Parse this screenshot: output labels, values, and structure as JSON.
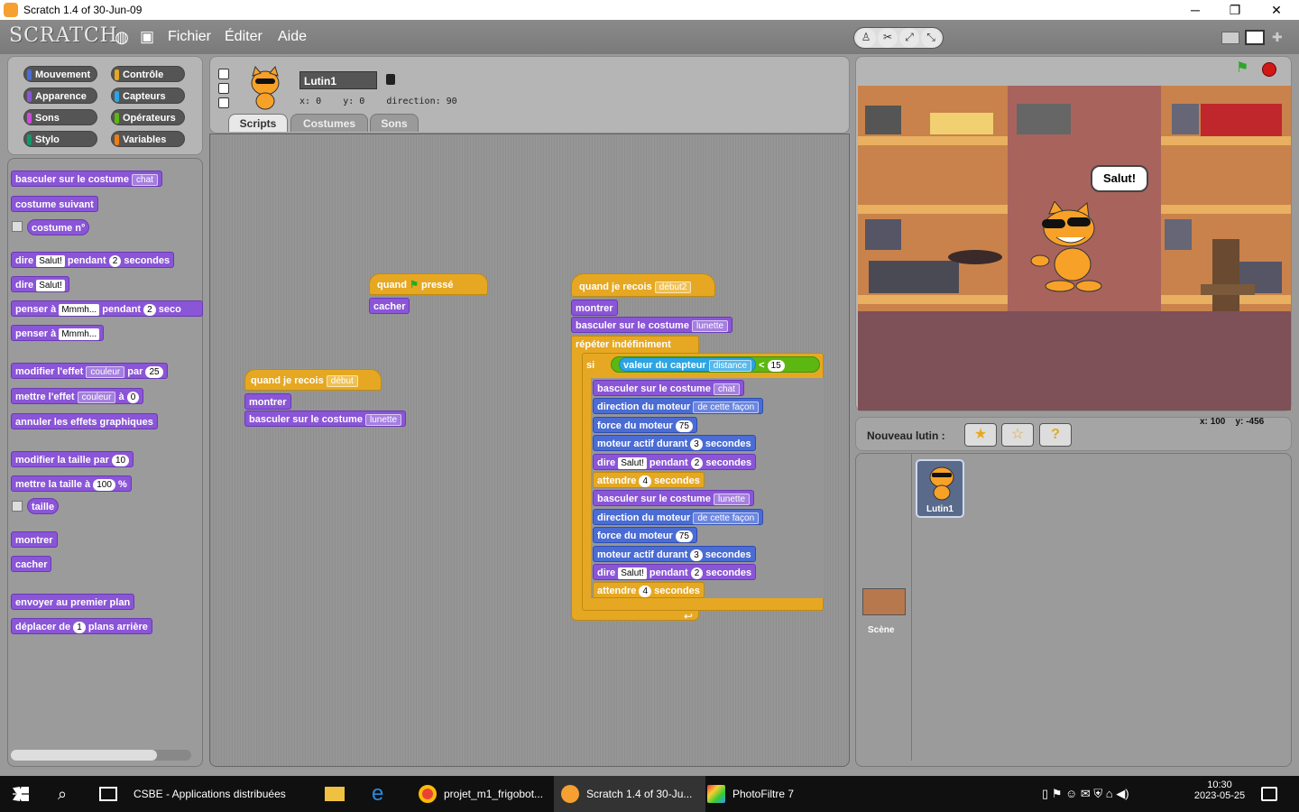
{
  "window": {
    "title": "Scratch 1.4 of 30-Jun-09",
    "controls": [
      "─",
      "❐",
      "✕"
    ]
  },
  "menu": {
    "logo": "SCRATCH",
    "items": [
      "Fichier",
      "Éditer",
      "Aide"
    ]
  },
  "categories": [
    {
      "label": "Mouvement",
      "color": "#4a6cd4"
    },
    {
      "label": "Contrôle",
      "color": "#e6a822"
    },
    {
      "label": "Apparence",
      "color": "#8a55d7"
    },
    {
      "label": "Capteurs",
      "color": "#2ca5e2"
    },
    {
      "label": "Sons",
      "color": "#cf4ad9"
    },
    {
      "label": "Opérateurs",
      "color": "#5cb712"
    },
    {
      "label": "Stylo",
      "color": "#0e9a6c"
    },
    {
      "label": "Variables",
      "color": "#ee7d16"
    }
  ],
  "palette": {
    "switch_costume": "basculer sur le costume",
    "switch_costume_value": "chat",
    "next_costume": "costume suivant",
    "costume_num": "costume n°",
    "say_for": "dire",
    "say_for_text": "Salut!",
    "say_for_mid": "pendant",
    "say_for_num": "2",
    "say_for_end": "secondes",
    "say": "dire",
    "say_text": "Salut!",
    "think_for": "penser à",
    "think_for_text": "Mmmh...",
    "think_for_mid": "pendant",
    "think_for_num": "2",
    "think_for_end": "seco",
    "think": "penser à",
    "think_text": "Mmmh...",
    "change_effect": "modifier l'effet",
    "change_effect_value": "couleur",
    "change_effect_mid": "par",
    "change_effect_num": "25",
    "set_effect": "mettre l'effet",
    "set_effect_value": "couleur",
    "set_effect_mid": "à",
    "set_effect_num": "0",
    "clear_effects": "annuler les effets graphiques",
    "change_size": "modifier la taille par",
    "change_size_num": "10",
    "set_size": "mettre la taille à",
    "set_size_num": "100",
    "set_size_unit": "%",
    "size": "taille",
    "show": "montrer",
    "hide": "cacher",
    "front": "envoyer au premier plan",
    "back": "déplacer de",
    "back_num": "1",
    "back_end": "plans arrière"
  },
  "sprite": {
    "name": "Lutin1",
    "x_label": "x:",
    "x": "0",
    "y_label": "y:",
    "y": "0",
    "direction_label": "direction:",
    "direction": "90"
  },
  "tabs": [
    "Scripts",
    "Costumes",
    "Sons"
  ],
  "scripts": {
    "s1_hat": "quand",
    "s1_hat_end": "pressé",
    "s1_hide": "cacher",
    "s2_hat": "quand je recois",
    "s2_hat_value": "début",
    "s2_show": "montrer",
    "s2_switch": "basculer sur le costume",
    "s2_switch_value": "lunette",
    "s3_hat": "quand je recois",
    "s3_hat_value": "début2",
    "s3_show": "montrer",
    "s3_switch": "basculer sur le costume",
    "s3_switch_value": "lunette",
    "s3_forever": "répéter indéfiniment",
    "s3_if": "si",
    "s3_sensor": "valeur du capteur",
    "s3_sensor_value": "distance",
    "s3_lt": "<",
    "s3_lt_num": "15",
    "inner": [
      {
        "kind": "look",
        "text": "basculer sur le costume",
        "dd": "chat"
      },
      {
        "kind": "motion",
        "text": "direction du moteur",
        "dd": "de cette façon"
      },
      {
        "kind": "motion",
        "text": "force du moteur",
        "num": "75"
      },
      {
        "kind": "motion",
        "text": "moteur actif durant",
        "num": "3",
        "end": "secondes"
      },
      {
        "kind": "look",
        "text": "dire",
        "slot": "Salut!",
        "mid": "pendant",
        "num": "2",
        "end": "secondes"
      },
      {
        "kind": "ctrl",
        "text": "attendre",
        "num": "4",
        "end": "secondes"
      },
      {
        "kind": "look",
        "text": "basculer sur le costume",
        "dd": "lunette"
      },
      {
        "kind": "motion",
        "text": "direction du moteur",
        "dd": "de cette façon"
      },
      {
        "kind": "motion",
        "text": "force du moteur",
        "num": "75"
      },
      {
        "kind": "motion",
        "text": "moteur actif durant",
        "num": "3",
        "end": "secondes"
      },
      {
        "kind": "look",
        "text": "dire",
        "slot": "Salut!",
        "mid": "pendant",
        "num": "2",
        "end": "secondes"
      },
      {
        "kind": "ctrl",
        "text": "attendre",
        "num": "4",
        "end": "secondes"
      }
    ]
  },
  "stage": {
    "speech": "Salut!",
    "mouse_x_label": "x:",
    "mouse_x": "100",
    "mouse_y_label": "y:",
    "mouse_y": "-456"
  },
  "new_sprite": {
    "label": "Nouveau lutin :"
  },
  "sprite_list": {
    "sprite": "Lutin1",
    "stage": "Scène"
  },
  "taskbar": {
    "apps": [
      "CSBE - Applications distribuées",
      "projet_m1_frigobot...",
      "Scratch 1.4 of 30-Ju...",
      "PhotoFiltre 7"
    ],
    "time": "10:30",
    "date": "2023-05-25"
  }
}
